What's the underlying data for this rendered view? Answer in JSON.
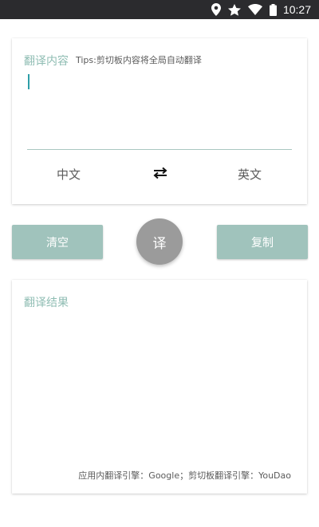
{
  "status_bar": {
    "time": "10:27",
    "icons": [
      "location-icon",
      "star-icon",
      "wifi-icon",
      "battery-icon"
    ]
  },
  "input_card": {
    "title": "翻译内容",
    "tips": "Tips:剪切板内容将全局自动翻译",
    "input_value": "",
    "source_language": "中文",
    "target_language": "英文",
    "swap_icon": "swap-arrows-icon"
  },
  "actions": {
    "clear_label": "清空",
    "translate_label": "译",
    "copy_label": "复制"
  },
  "result_card": {
    "title": "翻译结果",
    "result_text": "",
    "engine_note": "应用内翻译引擎：Google；剪切板翻译引擎：YouDao"
  },
  "colors": {
    "accent": "#8fbdb3",
    "button": "#a0c3bc",
    "translate_button": "#9b9b9b",
    "cursor": "#2e9ea8",
    "status_bar": "#2b2b2e"
  }
}
